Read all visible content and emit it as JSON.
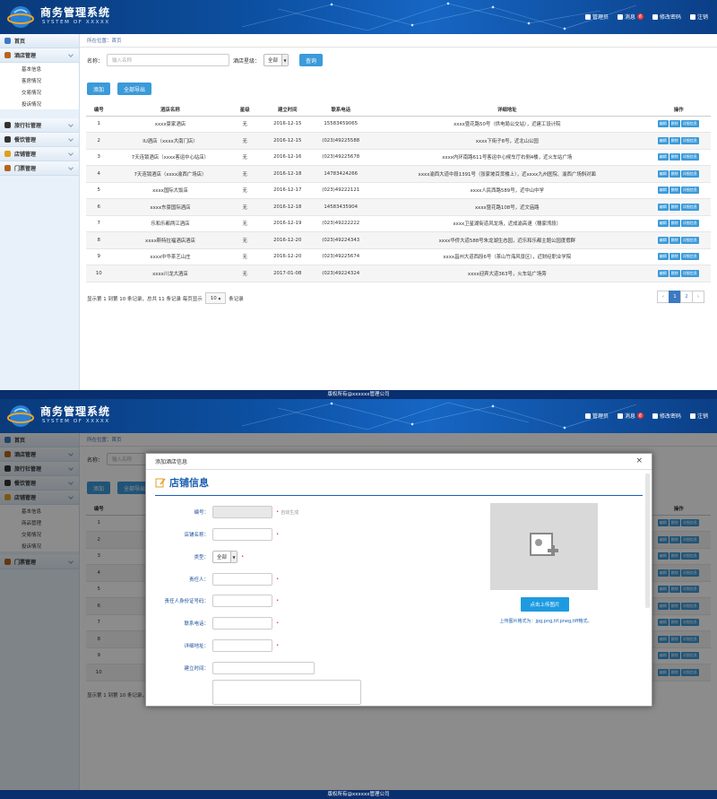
{
  "brand": {
    "title": "商务管理系统",
    "subtitle": "SYSTEM OF XXXXX"
  },
  "header": {
    "user": "管理员",
    "messages": "消息",
    "msg_count": "6",
    "change_pwd": "修改密码",
    "logout": "注销"
  },
  "breadcrumb": "所在位置：首页",
  "sidebar1": {
    "home": "首页",
    "hotel": "酒店管理",
    "hotel_sub": [
      "基本信息",
      "客房情况",
      "交易情况",
      "投诉情况"
    ],
    "travel": "旅行社管理",
    "food": "餐饮管理",
    "shop": "店铺管理",
    "ticket": "门票管理"
  },
  "sidebar2": {
    "home": "首页",
    "hotel": "酒店管理",
    "travel": "旅行社管理",
    "food": "餐饮管理",
    "shop": "店铺管理",
    "shop_sub": [
      "基本信息",
      "商品管理",
      "交易情况",
      "投诉情况"
    ],
    "ticket": "门票管理"
  },
  "search": {
    "name_label": "名称：",
    "name_placeholder": "输入名称",
    "star_label": "酒店星级：",
    "star_value": "全部",
    "query": "查询"
  },
  "toolbar": {
    "add": "添加",
    "export": "全部导出"
  },
  "table": {
    "headers": [
      "编号",
      "酒店名称",
      "星级",
      "建立时间",
      "联系电话",
      "详细地址",
      "操作"
    ],
    "ops": [
      "编辑",
      "删除",
      "详细信息"
    ],
    "rows": [
      [
        "1",
        "xxxx豪家酒店",
        "无",
        "2016-12-15",
        "15583459065",
        "xxxx暨花路50号（供电局公交站），近建工设计院"
      ],
      [
        "2",
        "IU酒店（xxxx大南门店）",
        "无",
        "2016-12-15",
        "(023)49225588",
        "xxxx下街子8号，近北山公园"
      ],
      [
        "3",
        "7天连锁酒店（xxxx客运中心站店）",
        "无",
        "2016-12-16",
        "(023)49225678",
        "xxxx内环南路611号客运中心候车厅右侧4楼，近火车站广场"
      ],
      [
        "4",
        "7天连锁酒店（xxxx渝西广场店）",
        "无",
        "2016-12-18",
        "14783424266",
        "xxxx渝西大道中段1391号（张家坡百货楼上），近xxxx九州医院、渝西广场斜对面"
      ],
      [
        "5",
        "xxxx国际大饭店",
        "无",
        "2016-12-17",
        "(023)49222121",
        "xxxx人民西路589号，近中山中学"
      ],
      [
        "6",
        "xxxx东豪国际酒店",
        "无",
        "2016-12-18",
        "14583435904",
        "xxxx暨花路108号，近文庙路"
      ],
      [
        "7",
        "乐和乐都两江酒店",
        "无",
        "2016-12-19",
        "(023)49222222",
        "xxxx卫星湖街道风龙场，近成渝高速（穗家湾段）"
      ],
      [
        "8",
        "xxxx斯特拉福酒店酒店",
        "无",
        "2016-12-20",
        "(023)49224343",
        "xxxx华侨大道588号朱龙湖生态园，近乐和乐都主题公园度假群"
      ],
      [
        "9",
        "xxxx中华茶艺山庄",
        "无",
        "2016-12-20",
        "(023)49225674",
        "xxxx昌州大道西段6号（茶山竹海风景区），近财经职业学院"
      ],
      [
        "10",
        "xxxx川龙大酒店",
        "无",
        "2017-01-08",
        "(023)49224324",
        "xxxx迎宾大道363号，火车站广场旁"
      ]
    ]
  },
  "footer": {
    "info_prefix": "显示第 1 到第 10 条记录，总共 11 条记录 每页显示",
    "page_size": "10",
    "info_suffix": "条记录",
    "pages": [
      "‹",
      "1",
      "2",
      "›"
    ]
  },
  "copyright": "版权所有@xxxxxx管理公司",
  "table2_ids": [
    "1",
    "2",
    "3",
    "4",
    "5",
    "6",
    "7",
    "8",
    "9",
    "10"
  ],
  "footer2": "显示第 1 到第 10 条记录，总共 11 条记录",
  "modal": {
    "window_title": "添加酒店信息",
    "heading": "店铺信息",
    "close": "×",
    "fields": [
      {
        "label": "编号：",
        "hint": "自动生成"
      },
      {
        "label": "店铺名称："
      },
      {
        "label": "类型：",
        "value": "全部"
      },
      {
        "label": "责任人："
      },
      {
        "label": "责任人身份证号码："
      },
      {
        "label": "联系电话："
      },
      {
        "label": "详细地址："
      },
      {
        "label": "建立时间："
      }
    ],
    "upload_button": "点击上传图片",
    "upload_hint": "上传图片格式为：jpg,png,tif,pneg,tiff格式。"
  },
  "colors": {
    "accent": "#3b9ad9",
    "header": "#0c4fa0",
    "required": "#e33333"
  }
}
